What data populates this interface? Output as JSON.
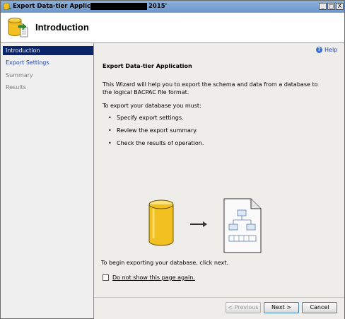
{
  "window": {
    "title_prefix": "Export Data-tier Application '",
    "title_suffix": "2015'",
    "minimize": "_",
    "maximize": "□",
    "close": "X"
  },
  "header": {
    "title": "Introduction"
  },
  "sidebar": {
    "items": [
      {
        "label": "Introduction",
        "state": "active"
      },
      {
        "label": "Export Settings",
        "state": "link"
      },
      {
        "label": "Summary",
        "state": "disabled"
      },
      {
        "label": "Results",
        "state": "disabled"
      }
    ]
  },
  "main": {
    "help_label": "Help",
    "section_title": "Export Data-tier Application",
    "intro_text": "This Wizard will help you to export the schema and data from a database to the logical BACPAC file format.",
    "must_text": "To export your database you must:",
    "bullets": [
      "Specify export settings.",
      "Review the export summary.",
      "Check the results of operation."
    ],
    "begin_text": "To begin exporting your database, click next.",
    "checkbox_label": "Do not show this page again.",
    "checkbox_checked": false
  },
  "footer": {
    "previous_label": "< Previous",
    "next_label": "Next >",
    "cancel_label": "Cancel"
  },
  "colors": {
    "titlebar": "#7aa3d6",
    "nav_active_bg": "#0a246a",
    "link": "#1a3fb3",
    "database_icon": "#f2c020"
  },
  "icons": {
    "title": "database-export-icon",
    "header": "database-export-icon",
    "help": "help-icon",
    "database": "database-icon",
    "arrow": "arrow-right-icon",
    "file": "bacpac-file-icon"
  }
}
